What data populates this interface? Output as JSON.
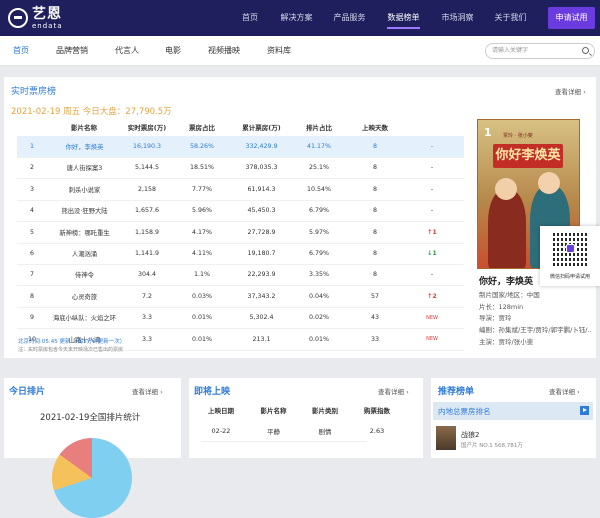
{
  "topnav": {
    "logo_cn": "艺恩",
    "logo_en": "endata",
    "items": [
      "首页",
      "解决方案",
      "产品服务",
      "数据榜单",
      "市场洞察",
      "关于我们"
    ],
    "active_index": 3,
    "cta_label": "申请试用"
  },
  "subnav": {
    "items": [
      "首页",
      "品牌营销",
      "代言人",
      "电影",
      "视频播映",
      "资料库"
    ],
    "active_index": 0,
    "search_placeholder": "请输入关键字"
  },
  "realtime": {
    "title": "实时票房榜",
    "more": "查看详细 ›",
    "date_line": "2021-02-19 周五   今日大盘：27,790.5万",
    "columns": [
      "",
      "影片名称",
      "实时票房(万)",
      "票房占比",
      "累计票房(万)",
      "排片占比",
      "上映天数",
      ""
    ],
    "rows": [
      {
        "rank": "1",
        "name": "你好，李焕英",
        "rt": "16,190.3",
        "share": "58.26%",
        "total": "332,429.9",
        "sched": "41.17%",
        "days": "8",
        "trend": "-"
      },
      {
        "rank": "2",
        "name": "唐人街探案3",
        "rt": "5,144.5",
        "share": "18.51%",
        "total": "378,035.3",
        "sched": "25.1%",
        "days": "8",
        "trend": "-"
      },
      {
        "rank": "3",
        "name": "刺杀小说家",
        "rt": "2,158",
        "share": "7.77%",
        "total": "61,914.3",
        "sched": "10.54%",
        "days": "8",
        "trend": "-"
      },
      {
        "rank": "4",
        "name": "熊出没·狂野大陆",
        "rt": "1,657.6",
        "share": "5.96%",
        "total": "45,450.3",
        "sched": "6.79%",
        "days": "8",
        "trend": "-"
      },
      {
        "rank": "5",
        "name": "新神榜：哪吒重生",
        "rt": "1,158.9",
        "share": "4.17%",
        "total": "27,728.9",
        "sched": "5.97%",
        "days": "8",
        "trend": "↑1"
      },
      {
        "rank": "6",
        "name": "人潮汹涌",
        "rt": "1,141.9",
        "share": "4.11%",
        "total": "19,180.7",
        "sched": "6.79%",
        "days": "8",
        "trend": "↓1"
      },
      {
        "rank": "7",
        "name": "侍神令",
        "rt": "304.4",
        "share": "1.1%",
        "total": "22,293.9",
        "sched": "3.35%",
        "days": "8",
        "trend": "-"
      },
      {
        "rank": "8",
        "name": "心灵奇旅",
        "rt": "7.2",
        "share": "0.03%",
        "total": "37,343.2",
        "sched": "0.04%",
        "days": "57",
        "trend": "↑2"
      },
      {
        "rank": "9",
        "name": "海底小纵队：火焰之环",
        "rt": "3.3",
        "share": "0.01%",
        "total": "5,302.4",
        "sched": "0.02%",
        "days": "43",
        "trend": "NEW"
      },
      {
        "rank": "10",
        "name": "山路十八湾",
        "rt": "3.3",
        "share": "0.01%",
        "total": "213.1",
        "sched": "0.01%",
        "days": "33",
        "trend": "NEW"
      }
    ],
    "footnote1": "北京时间:05:45 更新  （每5分钟更新一次）",
    "footnote2": "注：实时票房包含今天未开映场次已售出的票房"
  },
  "feature": {
    "poster_rank": "1",
    "poster_title": "你好李焕英",
    "poster_tag": "贾玲 · 张小斐",
    "movie_name": "你好，李焕英",
    "meta": [
      "制片国家/地区：中国",
      "片长：128min",
      "导演：贾玲",
      "编剧：孙集斌/王宇/贾玲/郭宇鹏/卜钰/...",
      "主演：贾玲/张小斐"
    ]
  },
  "qr": {
    "label": "微信扫码申请试用"
  },
  "today_sched": {
    "title": "今日排片",
    "more": "查看详细 ›",
    "chart_title": "2021-02-19全国排片统计"
  },
  "upcoming": {
    "title": "即将上映",
    "more": "查看详细 ›",
    "columns": [
      "上映日期",
      "影片名称",
      "影片类别",
      "购票指数"
    ],
    "rows": [
      {
        "date": "02-22",
        "name": "平静",
        "genre": "剧情",
        "index": "2.63"
      }
    ]
  },
  "recommend": {
    "title": "推荐榜单",
    "more": "查看详细 ›",
    "sub_label": "内地总票房排名",
    "item_title": "战狼2",
    "item_sub": "国产片 NO.1 568,781万"
  }
}
